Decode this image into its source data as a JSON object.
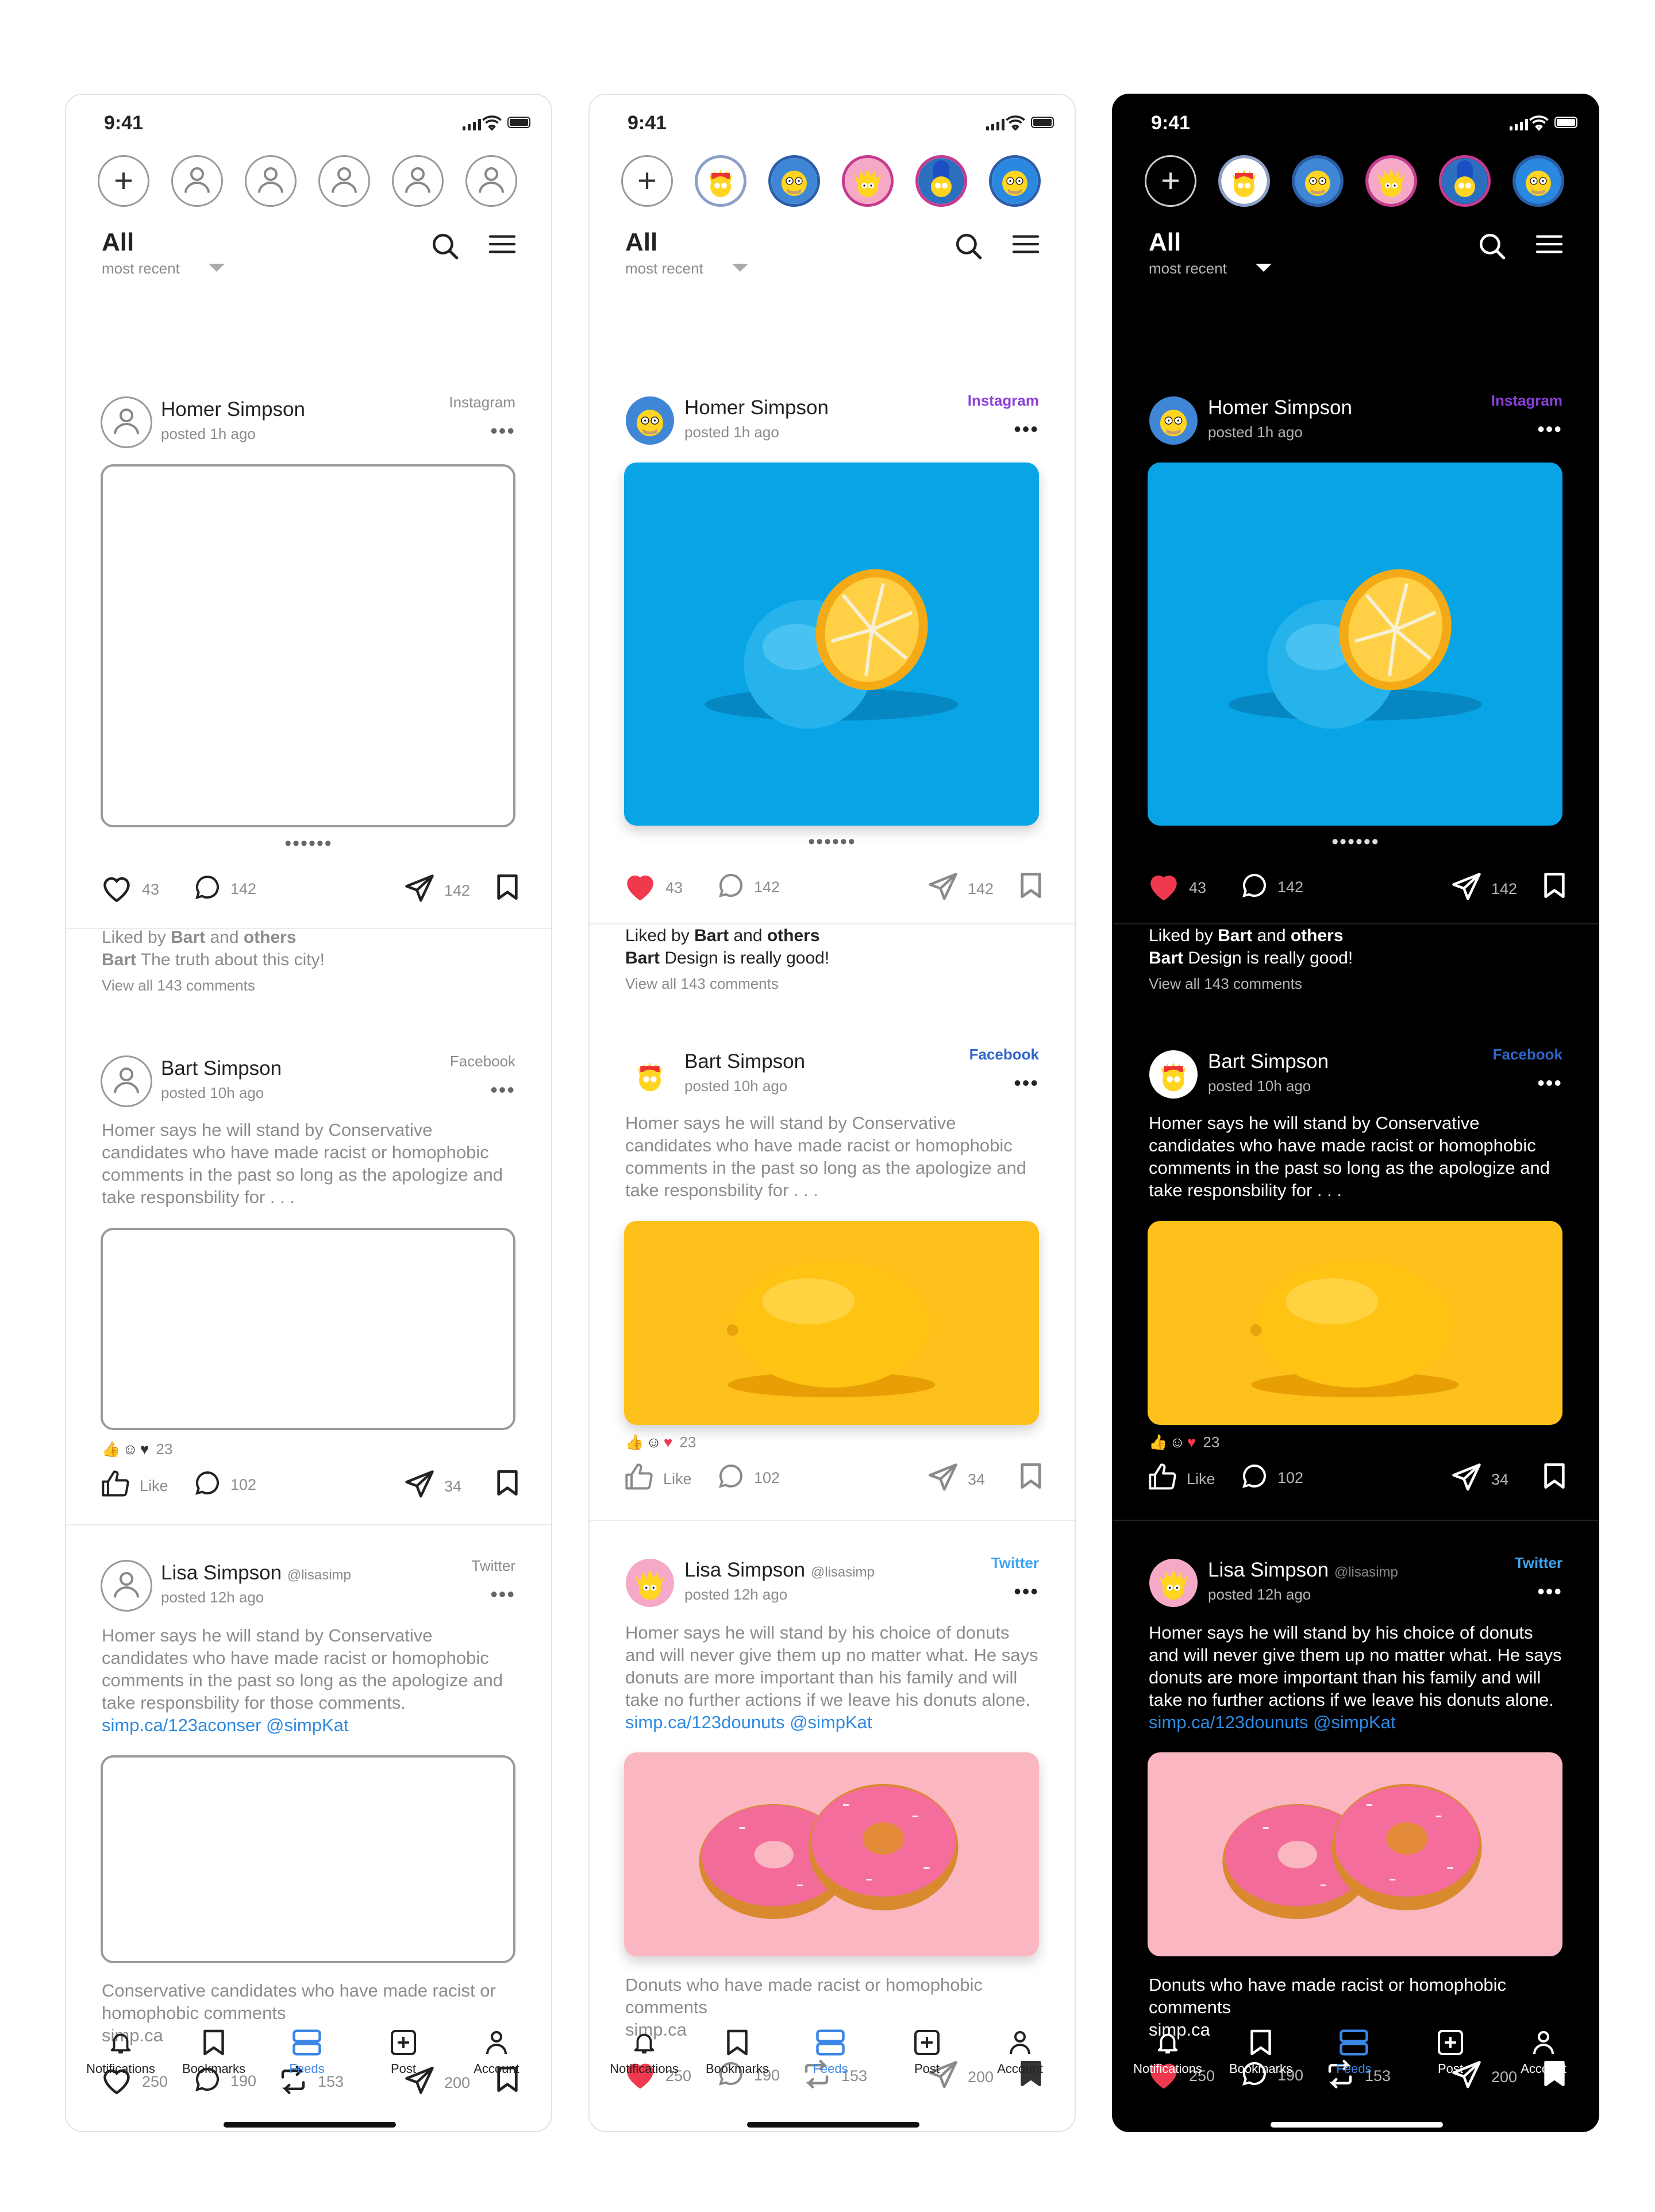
{
  "status": {
    "time": "9:41"
  },
  "header": {
    "title": "All",
    "sort": "most recent"
  },
  "posts": [
    {
      "author": "Homer Simpson",
      "handle": "",
      "time": "posted 1h ago",
      "source": "Instagram",
      "likes": "43",
      "comments": "142",
      "shares": "142",
      "liked_by_prefix": "Liked by",
      "liked_by_name": "Bart",
      "liked_by_and": "and",
      "liked_by_others": "others",
      "caption_author": "Bart",
      "view_all": "View all 143 comments"
    },
    {
      "author": "Bart Simpson",
      "handle": "",
      "time": "posted 10h ago",
      "source": "Facebook",
      "reactions": "23",
      "like_label": "Like",
      "comments": "102",
      "shares": "34"
    },
    {
      "author": "Lisa Simpson",
      "handle": "@lisasimp",
      "time": "posted 12h ago",
      "source": "Twitter",
      "likes": "250",
      "comments": "190",
      "retweets": "153",
      "shares": "200",
      "caption_domain": "simp.ca"
    }
  ],
  "variants": [
    {
      "theme": "wireframe",
      "post1_caption": "The truth about this city!",
      "post2_text": "Homer says he will stand by Conservative candidates who have made racist or homophobic comments in the past so long as the apologize and take responsbility for . . .",
      "post3_text": "Homer says he will stand by Conservative candidates who have made racist or homophobic comments in the past so long as the apologize and take responsbility for those comments.",
      "post3_link": "simp.ca/123aconser @simpKat",
      "post3_caption": "Conservative candidates who have made racist or homophobic comments"
    },
    {
      "theme": "light",
      "post1_caption": "Design is really good!",
      "post2_text": "Homer says he will stand by Conservative candidates who have made racist or homophobic comments in the past so long as the apologize and take responsbility for . . .",
      "post3_text": "Homer says he will stand by his choice of donuts and will never give them up no matter what. He says donuts are more important than his family and will take no further actions if we leave his donuts alone.",
      "post3_link": "simp.ca/123dounuts @simpKat",
      "post3_caption": "Donuts who have made racist or homophobic comments"
    },
    {
      "theme": "dark",
      "post1_caption": "Design is really good!",
      "post2_text": "Homer says he will stand by Conservative candidates who have made racist or homophobic comments in the past so long as the apologize and take responsbility for . . .",
      "post3_text": "Homer says he will stand by his choice of donuts and will never give them up no matter what. He says donuts are more important than his family and will take no further actions if we leave his donuts alone.",
      "post3_link": "simp.ca/123dounuts @simpKat",
      "post3_caption": "Donuts who have made racist or homophobic comments"
    }
  ],
  "source_colors": {
    "Instagram": "#8b3fd9",
    "Facebook": "#2f66c8",
    "Twitter": "#3ea4ef"
  },
  "tabs": [
    {
      "label": "Notifications",
      "icon": "bell-icon"
    },
    {
      "label": "Bookmarks",
      "icon": "bookmark-icon"
    },
    {
      "label": "Feeds",
      "icon": "feeds-icon",
      "active": true
    },
    {
      "label": "Post",
      "icon": "plus-square-icon"
    },
    {
      "label": "Account",
      "icon": "person-icon"
    }
  ],
  "colors": {
    "accent": "#3b86e6",
    "like": "#f0394f",
    "link": "#2f8ae0"
  }
}
